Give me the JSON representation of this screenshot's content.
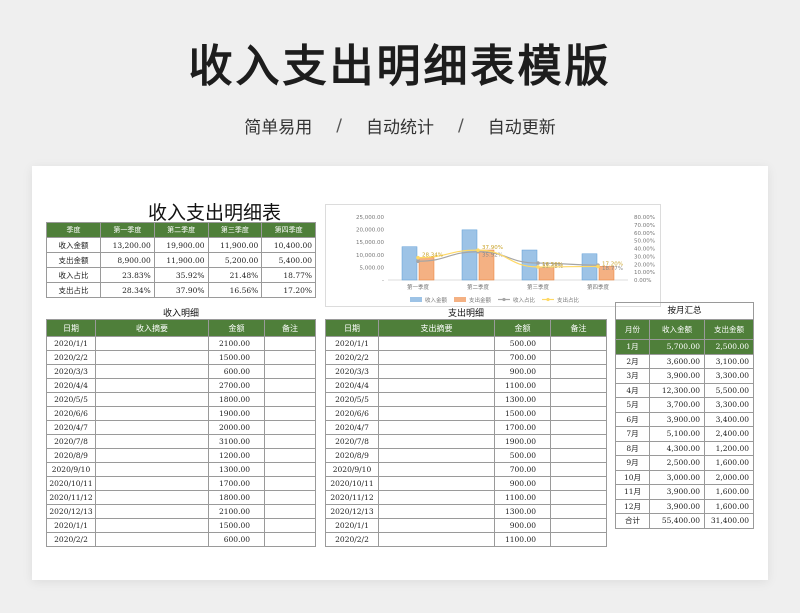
{
  "hero": {
    "title": "收入支出明细表模版",
    "tags": [
      "简单易用",
      "自动统计",
      "自动更新"
    ],
    "separator": "/"
  },
  "sheet": {
    "title": "收入支出明细表",
    "quarter_table": {
      "headers": [
        "季度",
        "第一季度",
        "第二季度",
        "第三季度",
        "第四季度"
      ],
      "rows": [
        {
          "label": "收入金额",
          "values": [
            "13,200.00",
            "19,900.00",
            "11,900.00",
            "10,400.00"
          ]
        },
        {
          "label": "支出金额",
          "values": [
            "8,900.00",
            "11,900.00",
            "5,200.00",
            "5,400.00"
          ]
        },
        {
          "label": "收入占比",
          "values": [
            "23.83%",
            "35.92%",
            "21.48%",
            "18.77%"
          ]
        },
        {
          "label": "支出占比",
          "values": [
            "28.34%",
            "37.90%",
            "16.56%",
            "17.20%"
          ]
        }
      ]
    },
    "income": {
      "section_title": "收入明细",
      "headers": [
        "日期",
        "收入摘要",
        "金额",
        "备注"
      ],
      "rows": [
        [
          "2020/1/1",
          "",
          "2100.00",
          ""
        ],
        [
          "2020/2/2",
          "",
          "1500.00",
          ""
        ],
        [
          "2020/3/3",
          "",
          "600.00",
          ""
        ],
        [
          "2020/4/4",
          "",
          "2700.00",
          ""
        ],
        [
          "2020/5/5",
          "",
          "1800.00",
          ""
        ],
        [
          "2020/6/6",
          "",
          "1900.00",
          ""
        ],
        [
          "2020/4/7",
          "",
          "2000.00",
          ""
        ],
        [
          "2020/7/8",
          "",
          "3100.00",
          ""
        ],
        [
          "2020/8/9",
          "",
          "1200.00",
          ""
        ],
        [
          "2020/9/10",
          "",
          "1300.00",
          ""
        ],
        [
          "2020/10/11",
          "",
          "1700.00",
          ""
        ],
        [
          "2020/11/12",
          "",
          "1800.00",
          ""
        ],
        [
          "2020/12/13",
          "",
          "2100.00",
          ""
        ],
        [
          "2020/1/1",
          "",
          "1500.00",
          ""
        ],
        [
          "2020/2/2",
          "",
          "600.00",
          ""
        ]
      ]
    },
    "expense": {
      "section_title": "支出明细",
      "headers": [
        "日期",
        "支出摘要",
        "金额",
        "备注"
      ],
      "rows": [
        [
          "2020/1/1",
          "",
          "500.00",
          ""
        ],
        [
          "2020/2/2",
          "",
          "700.00",
          ""
        ],
        [
          "2020/3/3",
          "",
          "900.00",
          ""
        ],
        [
          "2020/4/4",
          "",
          "1100.00",
          ""
        ],
        [
          "2020/5/5",
          "",
          "1300.00",
          ""
        ],
        [
          "2020/6/6",
          "",
          "1500.00",
          ""
        ],
        [
          "2020/4/7",
          "",
          "1700.00",
          ""
        ],
        [
          "2020/7/8",
          "",
          "1900.00",
          ""
        ],
        [
          "2020/8/9",
          "",
          "500.00",
          ""
        ],
        [
          "2020/9/10",
          "",
          "700.00",
          ""
        ],
        [
          "2020/10/11",
          "",
          "900.00",
          ""
        ],
        [
          "2020/11/12",
          "",
          "1100.00",
          ""
        ],
        [
          "2020/12/13",
          "",
          "1300.00",
          ""
        ],
        [
          "2020/1/1",
          "",
          "900.00",
          ""
        ],
        [
          "2020/2/2",
          "",
          "1100.00",
          ""
        ]
      ]
    },
    "monthly": {
      "section_title": "按月汇总",
      "headers": [
        "月份",
        "收入金额",
        "支出金额"
      ],
      "rows": [
        [
          "1月",
          "5,700.00",
          "2,500.00"
        ],
        [
          "2月",
          "3,600.00",
          "3,100.00"
        ],
        [
          "3月",
          "3,900.00",
          "3,300.00"
        ],
        [
          "4月",
          "12,300.00",
          "5,500.00"
        ],
        [
          "5月",
          "3,700.00",
          "3,300.00"
        ],
        [
          "6月",
          "3,900.00",
          "3,400.00"
        ],
        [
          "7月",
          "5,100.00",
          "2,400.00"
        ],
        [
          "8月",
          "4,300.00",
          "1,200.00"
        ],
        [
          "9月",
          "2,500.00",
          "1,600.00"
        ],
        [
          "10月",
          "3,000.00",
          "2,000.00"
        ],
        [
          "11月",
          "3,900.00",
          "1,600.00"
        ],
        [
          "12月",
          "3,900.00",
          "1,600.00"
        ],
        [
          "合计",
          "55,400.00",
          "31,400.00"
        ]
      ],
      "highlight_row": 0
    },
    "colors": {
      "header_green": "#4f7f3a",
      "income_bar": "#9dc3e6",
      "expense_bar": "#f4b183",
      "income_ratio_line": "#a5a5a5",
      "expense_ratio_line": "#ffd966"
    }
  },
  "chart_data": {
    "type": "bar",
    "categories": [
      "第一季度",
      "第二季度",
      "第三季度",
      "第四季度"
    ],
    "series": [
      {
        "name": "收入金额",
        "kind": "bar",
        "axis": "left",
        "values": [
          13200,
          19900,
          11900,
          10400
        ]
      },
      {
        "name": "支出金额",
        "kind": "bar",
        "axis": "left",
        "values": [
          8900,
          11900,
          5200,
          5400
        ]
      },
      {
        "name": "收入占比",
        "kind": "line",
        "axis": "right",
        "values": [
          0.2383,
          0.3592,
          0.2148,
          0.1877
        ]
      },
      {
        "name": "支出占比",
        "kind": "line",
        "axis": "right",
        "values": [
          0.2834,
          0.379,
          0.1656,
          0.172
        ]
      }
    ],
    "data_labels": {
      "收入占比": [
        "",
        "35.92%",
        "21.48%",
        "18.77%"
      ],
      "支出占比": [
        "28.34%",
        "37.90%",
        "16.56%",
        "17.20%"
      ]
    },
    "left_ticks": [
      "25,000.00",
      "20,000.00",
      "15,000.00",
      "10,000.00",
      "5,000.00",
      "-"
    ],
    "left_ylim": [
      0,
      25000
    ],
    "right_ticks": [
      "80.00%",
      "70.00%",
      "60.00%",
      "50.00%",
      "40.00%",
      "30.00%",
      "20.00%",
      "10.00%",
      "0.00%"
    ],
    "right_ylim": [
      0,
      0.8
    ],
    "legend_position": "bottom",
    "grid": false
  }
}
